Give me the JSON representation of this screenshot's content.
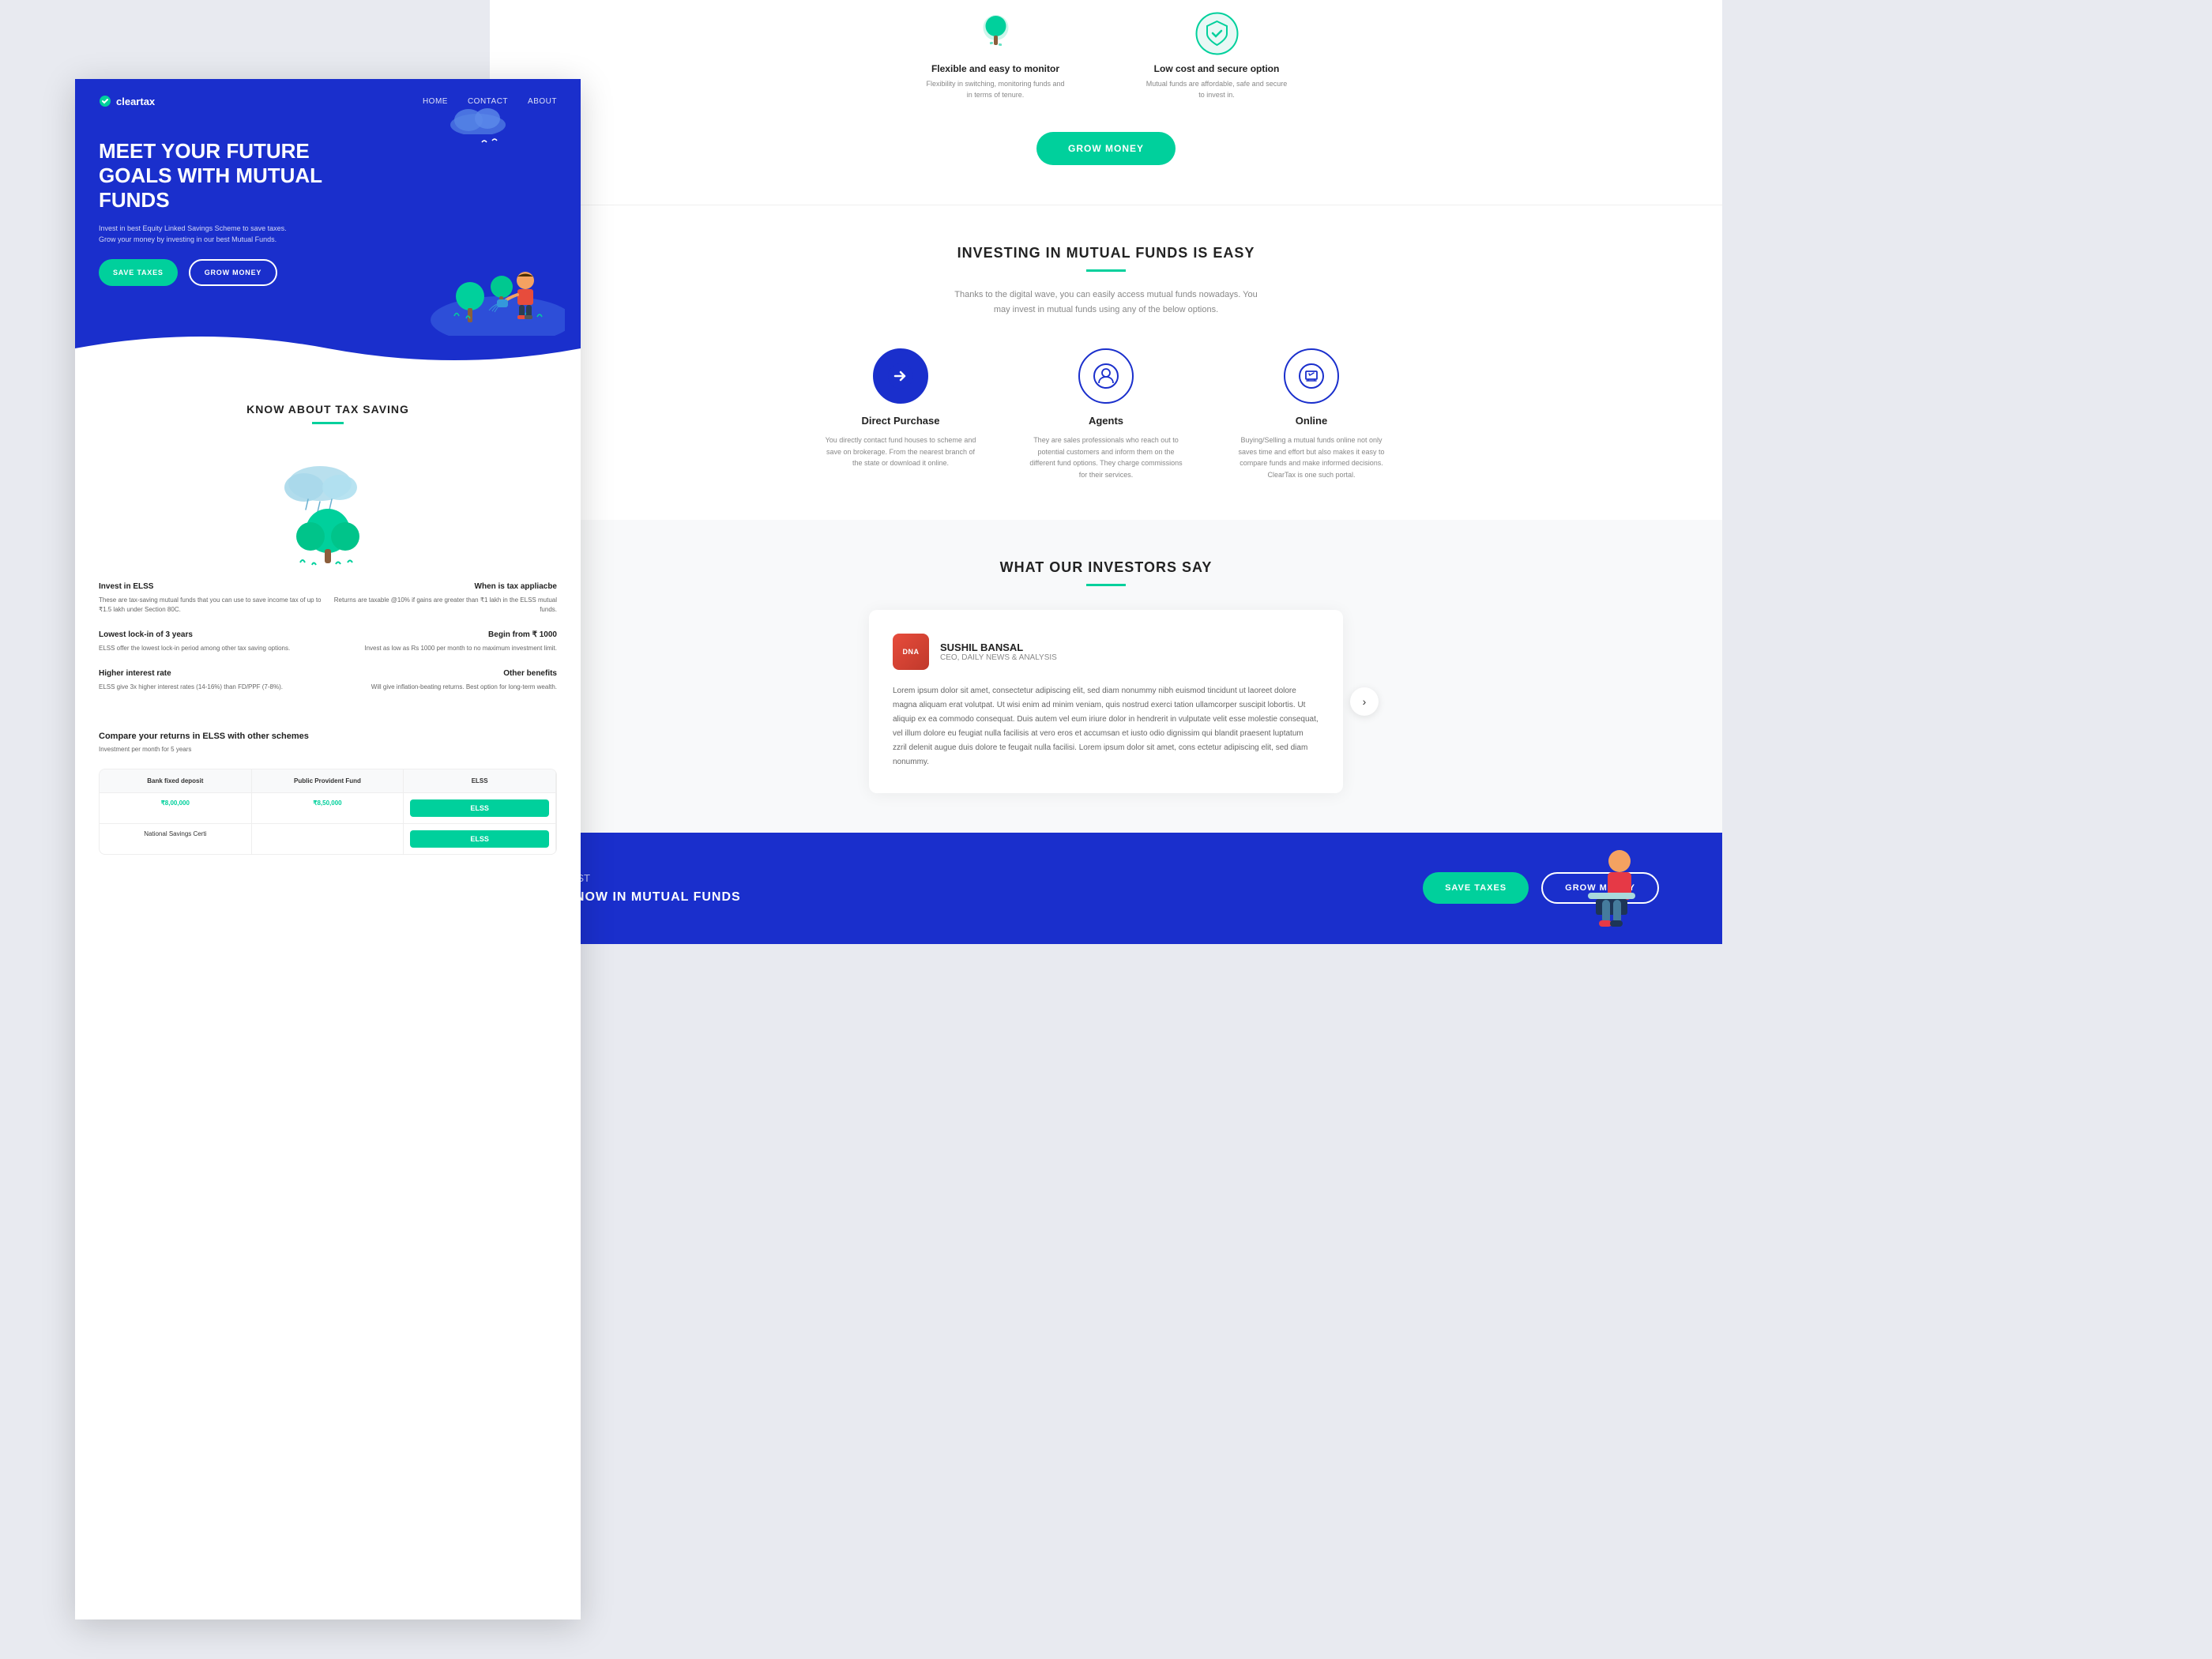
{
  "brand": {
    "name": "cleartax",
    "logo_label": "cleartax"
  },
  "nav": {
    "home": "HOME",
    "contact": "CONTACT",
    "about": "ABOUT"
  },
  "hero": {
    "title": "MEET YOUR FUTURE GOALS WITH MUTUAL FUNDS",
    "subtitle": "Invest in best Equity Linked Savings Scheme to save taxes. Grow your money by investing in our best Mutual Funds.",
    "btn_save": "SAVE TAXES",
    "btn_grow": "GROW MONEY"
  },
  "tax_section": {
    "title": "KNOW ABOUT TAX SAVING",
    "items": [
      {
        "title": "Invest in ELSS",
        "text": "These are tax-saving mutual funds that you can use to save income tax of up to ₹1.5 lakh under Section 80C."
      },
      {
        "title": "When is tax appliacbe",
        "text": "Returns are taxable @10% if gains are greater than ₹1 lakh in the ELSS mutual funds."
      },
      {
        "title": "Lowest lock-in of 3 years",
        "text": "ELSS offer the lowest lock-in period among other tax saving options."
      },
      {
        "title": "Begin from ₹ 1000",
        "text": "Invest as low as Rs 1000 per month to no maximum investment limit."
      },
      {
        "title": "Higher interest rate",
        "text": "ELSS give 3x higher interest rates (14-16%) than FD/PPF (7-8%)."
      },
      {
        "title": "Other benefits",
        "text": "Will give inflation-beating returns. Best option for long-term wealth."
      }
    ]
  },
  "compare_section": {
    "title": "Compare your returns in ELSS with other schemes",
    "subtitle": "Investment per month for 5 years",
    "columns": [
      "Bank fixed deposit",
      "Public Provident Fund",
      "ELSS"
    ],
    "amounts": [
      "₹8,00,000",
      "₹8,50,000",
      "ELSS"
    ],
    "row2": [
      "National Savings Certi",
      "",
      "ELSS"
    ]
  },
  "right_page": {
    "features": [
      {
        "icon": "tree-icon",
        "title": "Flexible and easy to monitor",
        "text": "Flexibility in switching, monitoring funds and in terms of tenure."
      },
      {
        "icon": "shield-icon",
        "title": "Low cost and secure option",
        "text": "Mutual funds are affordable, safe and secure to invest in."
      }
    ],
    "grow_money_btn": "GROW MONEY",
    "investing_title": "INVESTING IN MUTUAL FUNDS IS EASY",
    "investing_text": "Thanks to the digital wave, you can easily access mutual funds nowadays. You may invest in mutual funds using any of the below options.",
    "methods": [
      {
        "icon": "arrow-right-icon",
        "title": "Direct Purchase",
        "text": "You directly contact fund houses to scheme and save on brokerage. From the nearest branch of the state or download it online.",
        "active": true
      },
      {
        "icon": "person-icon",
        "title": "Agents",
        "text": "They are sales professionals who reach out to potential customers and inform them on the different fund options. They charge commissions for their services."
      },
      {
        "icon": "document-icon",
        "title": "Online",
        "text": "Buying/Selling a mutual funds online not only saves time and effort but also makes it easy to compare funds and make informed decisions. ClearTax is one such portal."
      }
    ],
    "testimonial_title": "WHAT OUR INVESTORS SAY",
    "testimonial": {
      "author_name": "SUSHIL BANSAL",
      "author_title": "CEO, DAILY NEWS & ANALYSIS",
      "text": "Lorem ipsum dolor sit amet, consectetur adipiscing elit, sed diam nonummy nibh euismod tincidunt ut laoreet dolore magna aliquam erat volutpat. Ut wisi enim ad minim veniam, quis nostrud exerci tation ullamcorper suscipit lobortis. Ut aliquip ex ea commodo consequat. Duis autem vel eum iriure dolor in hendrerit in vulputate velit esse molestie consequat, vel illum dolore eu feugiat nulla facilisis at vero eros et accumsan et iusto odio dignissim qui blandit praesent luptatum zzril delenit augue duis dolore te feugait nulla facilisi. Lorem ipsum dolor sit amet, cons ectetur adipiscing elit, sed diam nonummy."
    },
    "cta": {
      "text": "ST NOW IN MUTUAL FUNDS",
      "btn_save": "SAVE TAXES",
      "btn_grow": "GROW MONEY"
    }
  }
}
